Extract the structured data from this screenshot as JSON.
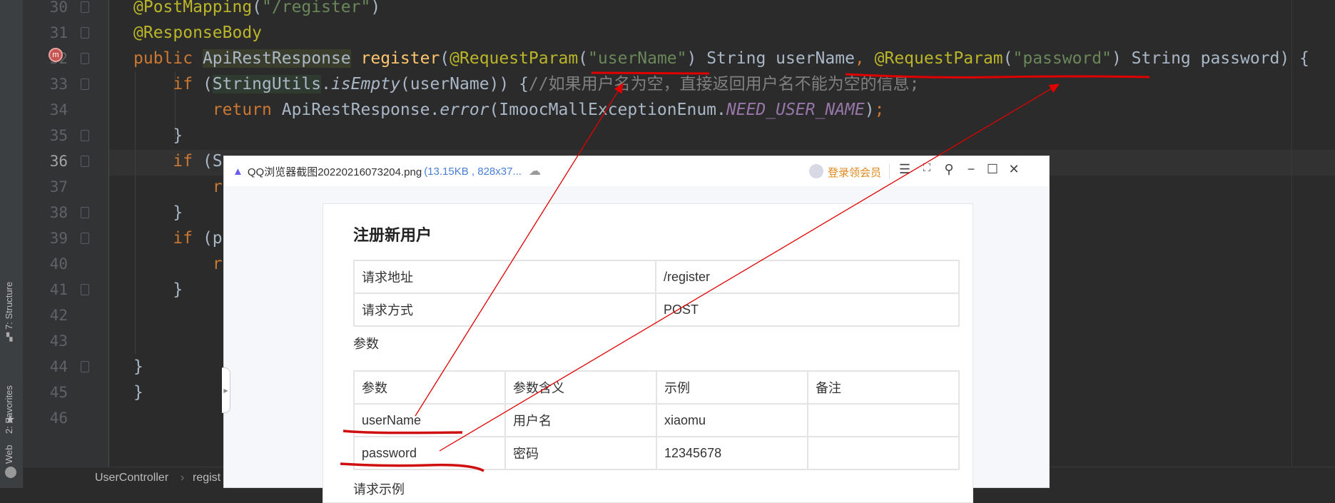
{
  "ide": {
    "tool_windows": [
      "7: Structure",
      "2: Favorites",
      "Web"
    ],
    "line_numbers": [
      "30",
      "31",
      "32",
      "33",
      "34",
      "35",
      "36",
      "37",
      "38",
      "39",
      "40",
      "41",
      "42",
      "43",
      "44",
      "45",
      "46"
    ],
    "current_line": "36",
    "breadcrumb": [
      "UserController",
      "regist"
    ],
    "code": [
      [
        {
          "t": "@PostMapping",
          "c": "ann"
        },
        {
          "t": "(",
          "c": ""
        },
        {
          "t": "\"/register\"",
          "c": "str"
        },
        {
          "t": ")",
          "c": ""
        }
      ],
      [
        {
          "t": "@ResponseBody",
          "c": "ann"
        }
      ],
      [
        {
          "t": "public ",
          "c": "kw"
        },
        {
          "t": "ApiRestResponse",
          "c": "hl"
        },
        {
          "t": " ",
          "c": ""
        },
        {
          "t": "register",
          "c": "fn"
        },
        {
          "t": "(",
          "c": ""
        },
        {
          "t": "@RequestParam",
          "c": "ann"
        },
        {
          "t": "(",
          "c": ""
        },
        {
          "t": "\"userName\"",
          "c": "str"
        },
        {
          "t": ") String userName",
          "c": ""
        },
        {
          "t": ", ",
          "c": "kw"
        },
        {
          "t": "@RequestParam",
          "c": "ann"
        },
        {
          "t": "(",
          "c": ""
        },
        {
          "t": "\"password\"",
          "c": "str"
        },
        {
          "t": ") String password) {",
          "c": ""
        }
      ],
      [
        {
          "t": "    if ",
          "c": "kw"
        },
        {
          "t": "(",
          "c": ""
        },
        {
          "t": "StringUtils",
          "c": "hlg"
        },
        {
          "t": ".",
          "c": ""
        },
        {
          "t": "isEmpty",
          "c": "it"
        },
        {
          "t": "(userName)) {",
          "c": ""
        },
        {
          "t": "//如果用户名为空，直接返回用户名不能为空的信息;",
          "c": "cm"
        }
      ],
      [
        {
          "t": "        return ",
          "c": "kw"
        },
        {
          "t": "ApiRestResponse.",
          "c": ""
        },
        {
          "t": "error",
          "c": "it"
        },
        {
          "t": "(ImoocMallExceptionEnum.",
          "c": ""
        },
        {
          "t": "NEED_USER_NAME",
          "c": "fld"
        },
        {
          "t": ")",
          "c": ""
        },
        {
          "t": ";",
          "c": "kw"
        }
      ],
      [
        {
          "t": "    }",
          "c": ""
        }
      ],
      [
        {
          "t": "    if ",
          "c": "kw"
        },
        {
          "t": "(S",
          "c": ""
        }
      ],
      [
        {
          "t": "        r",
          "c": "kw"
        }
      ],
      [
        {
          "t": "    }",
          "c": ""
        }
      ],
      [
        {
          "t": "    if ",
          "c": "kw"
        },
        {
          "t": "(p",
          "c": ""
        }
      ],
      [
        {
          "t": "        r",
          "c": "kw"
        }
      ],
      [
        {
          "t": "    }",
          "c": ""
        }
      ],
      [],
      [],
      [
        {
          "t": "}",
          "c": ""
        }
      ],
      [
        {
          "t": "}",
          "c": ""
        }
      ],
      []
    ]
  },
  "viewer": {
    "filename": "QQ浏览器截图20220216073204.png",
    "fileinfo": "(13.15KB , 828x37...",
    "login_label": "登录领会员",
    "doc": {
      "title": "注册新用户",
      "info_rows": [
        [
          "请求地址",
          "/register"
        ],
        [
          "请求方式",
          "POST"
        ]
      ],
      "params_label": "参数",
      "params_header": [
        "参数",
        "参数含义",
        "示例",
        "备注"
      ],
      "params_rows": [
        [
          "userName",
          "用户名",
          "xiaomu",
          ""
        ],
        [
          "password",
          "密码",
          "12345678",
          ""
        ]
      ],
      "next_section": "请求示例"
    }
  },
  "colors": {
    "annotation": "#e00000",
    "bg": "#2b2b2b"
  }
}
